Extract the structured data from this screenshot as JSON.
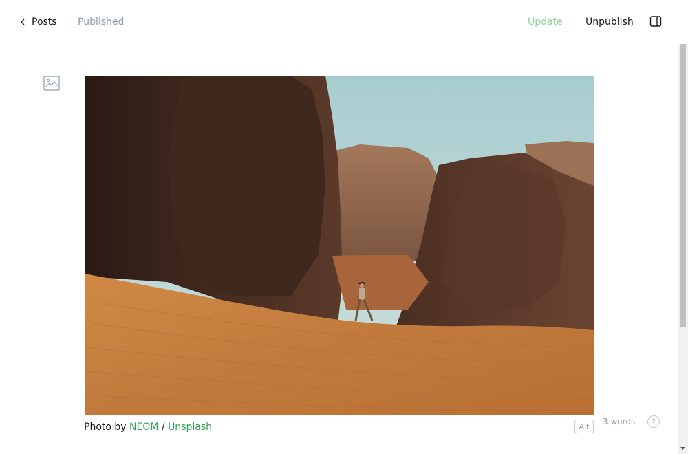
{
  "header": {
    "back_label": "Posts",
    "status": "Published",
    "update_label": "Update",
    "unpublish_label": "Unpublish"
  },
  "image_card": {
    "caption_prefix": "Photo by ",
    "caption_author": "NEOM",
    "caption_separator": " / ",
    "caption_source": "Unsplash",
    "alt_label": "Alt"
  },
  "footer": {
    "word_count": "3 words",
    "help_label": "?"
  },
  "colors": {
    "accent_green": "#30a14e",
    "update_green": "#8fd39a",
    "muted": "#8e9cac"
  }
}
